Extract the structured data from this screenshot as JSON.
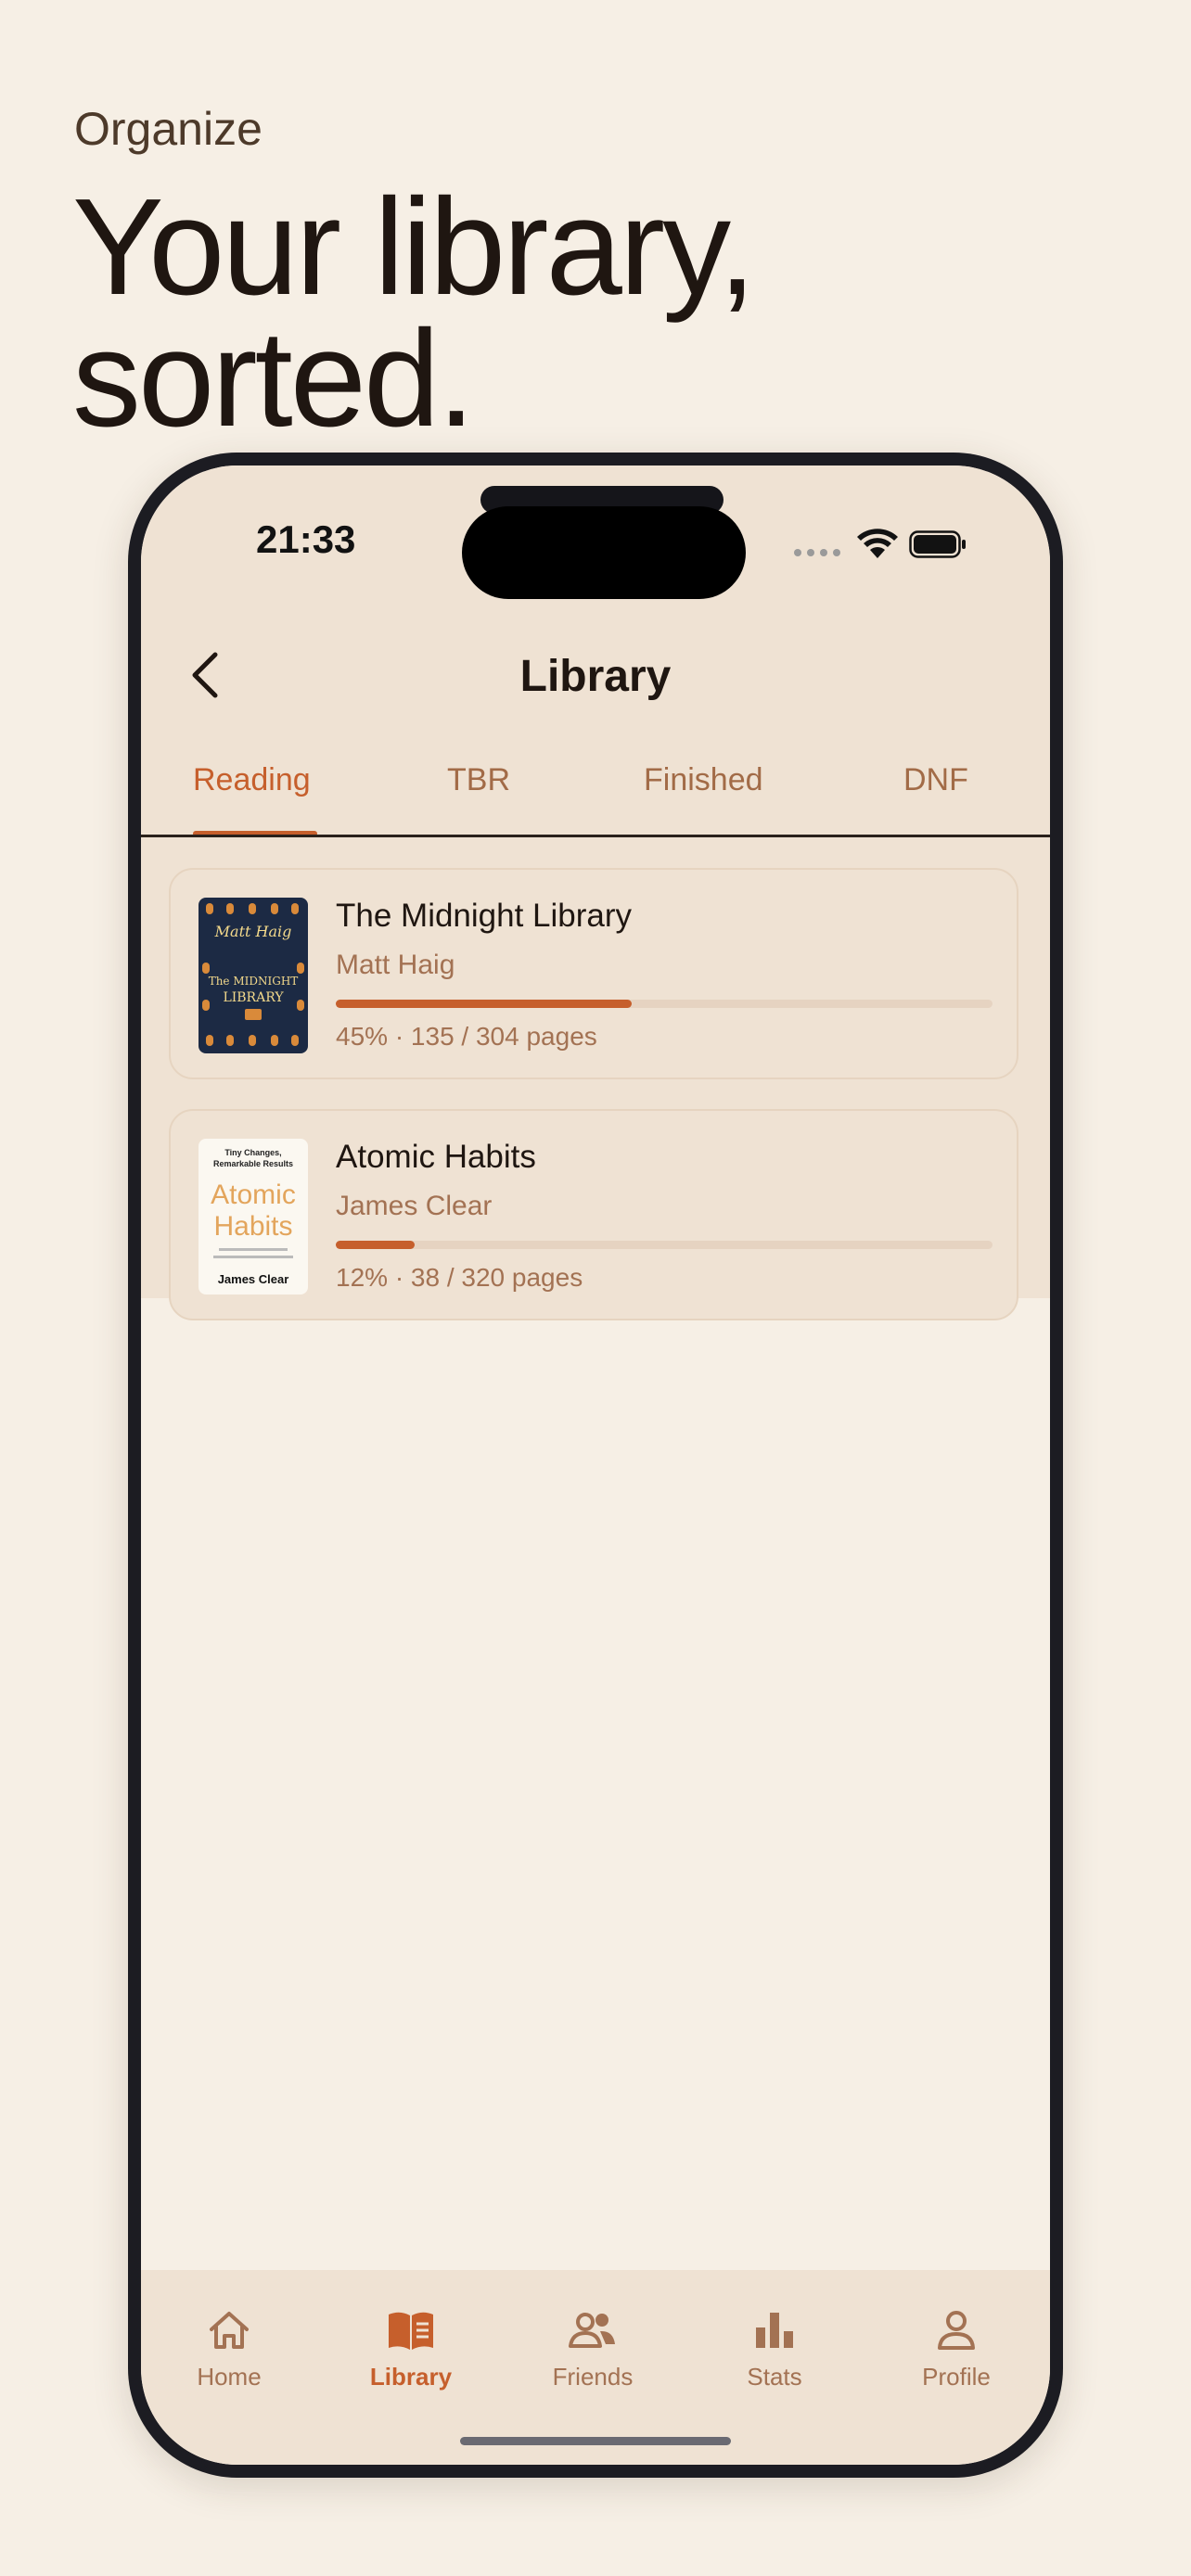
{
  "promo": {
    "eyebrow": "Organize",
    "headline_line1": "Your library,",
    "headline_line2": "sorted."
  },
  "status_bar": {
    "time": "21:33"
  },
  "header": {
    "title": "Library",
    "back_icon": "chevron-left-icon"
  },
  "tabs": [
    {
      "label": "Reading",
      "active": true
    },
    {
      "label": "TBR",
      "active": false
    },
    {
      "label": "Finished",
      "active": false
    },
    {
      "label": "DNF",
      "active": false
    }
  ],
  "books": [
    {
      "title": "The Midnight Library",
      "author": "Matt Haig",
      "progress": 0.45,
      "meta": "45% · 135 / 304 pages",
      "cover": {
        "author": "Matt Haig",
        "title_top": "The MIDNIGHT",
        "title_bottom": "LIBRARY"
      }
    },
    {
      "title": "Atomic Habits",
      "author": "James Clear",
      "progress": 0.12,
      "meta": "12% · 38 / 320 pages",
      "cover": {
        "tagline_1": "Tiny Changes,",
        "tagline_2": "Remarkable Results",
        "title_1": "Atomic",
        "title_2": "Habits",
        "author": "James Clear"
      }
    }
  ],
  "bottom_nav": [
    {
      "label": "Home",
      "icon": "home-icon",
      "active": false
    },
    {
      "label": "Library",
      "icon": "book-icon",
      "active": true
    },
    {
      "label": "Friends",
      "icon": "friends-icon",
      "active": false
    },
    {
      "label": "Stats",
      "icon": "bar-chart-icon",
      "active": false
    },
    {
      "label": "Profile",
      "icon": "person-icon",
      "active": false
    }
  ],
  "colors": {
    "accent": "#c65f2c",
    "background": "#f6efe5",
    "surface": "#efe2d3",
    "muted_text": "#a37253"
  }
}
